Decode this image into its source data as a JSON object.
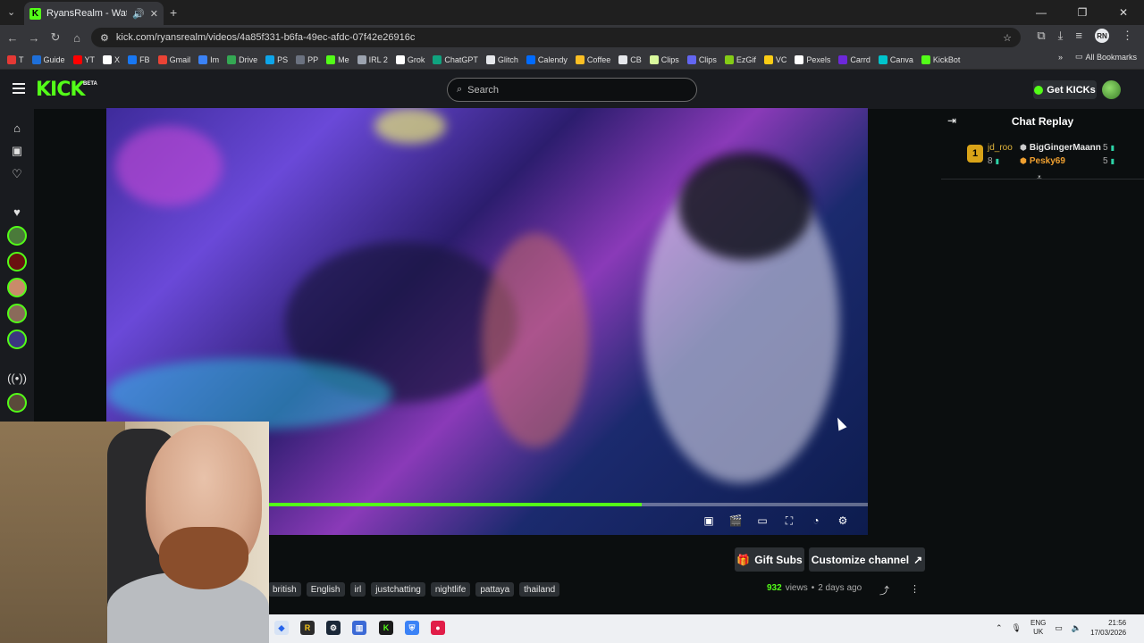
{
  "browser": {
    "tab_title": "RyansRealm - Watch the VOD",
    "url": "kick.com/ryansrealm/videos/4a85f331-b6fa-49ec-afdc-07f42e26916c",
    "bookmarks": [
      "T",
      "Guide",
      "YT",
      "X",
      "FB",
      "Gmail",
      "Im",
      "Drive",
      "PS",
      "PP",
      "Me",
      "IRL 2",
      "Grok",
      "ChatGPT",
      "Glitch",
      "Calendy",
      "Coffee",
      "CB",
      "Clips",
      "Clips",
      "EzGif",
      "VC",
      "Pexels",
      "Carrd",
      "Canva",
      "KickBot"
    ],
    "bookmark_colors": [
      "#e53935",
      "#1e6fd9",
      "#ff0000",
      "#ffffff",
      "#1877f2",
      "#ea4335",
      "#3b82f6",
      "#34a853",
      "#0ea5e9",
      "#6b7280",
      "#53fc18",
      "#9ca3af",
      "#ffffff",
      "#10a37f",
      "#e5e7eb",
      "#006bff",
      "#fbbf24",
      "#e5e7eb",
      "#d9f99d",
      "#6366f1",
      "#84cc16",
      "#facc15",
      "#ffffff",
      "#6d28d9",
      "#00c4cc",
      "#53fc18"
    ],
    "all_bookmarks": "All Bookmarks",
    "profile_initials": "RN"
  },
  "kick": {
    "logo": "KICK",
    "logo_badge": "BETA",
    "search_placeholder": "Search",
    "get_kicks": "Get KICKs",
    "progress_fraction": 0.623
  },
  "chat": {
    "title": "Chat Replay",
    "leaderboard": [
      {
        "rank": "1",
        "name": "jd_roo",
        "count": "8",
        "name_color": "#e0b43c"
      },
      {
        "name": "BigGingerMaann",
        "count": "5",
        "name_color": "#e8e8e8"
      },
      {
        "name": "Pesky69",
        "count": "5",
        "name_color": "#f0a030"
      }
    ]
  },
  "video_info": {
    "gift_subs": "Gift Subs",
    "customize_channel": "Customize channel",
    "tags": [
      "british",
      "English",
      "irl",
      "justchatting",
      "nightlife",
      "pattaya",
      "thailand"
    ],
    "views_count": "932",
    "views_label": "views",
    "separator": "•",
    "age": "2 days ago"
  },
  "taskbar": {
    "lang_top": "ENG",
    "lang_bottom": "UK",
    "time": "21:56",
    "date": "17/03/2026"
  },
  "icons": {
    "accent": "#53fc18"
  }
}
